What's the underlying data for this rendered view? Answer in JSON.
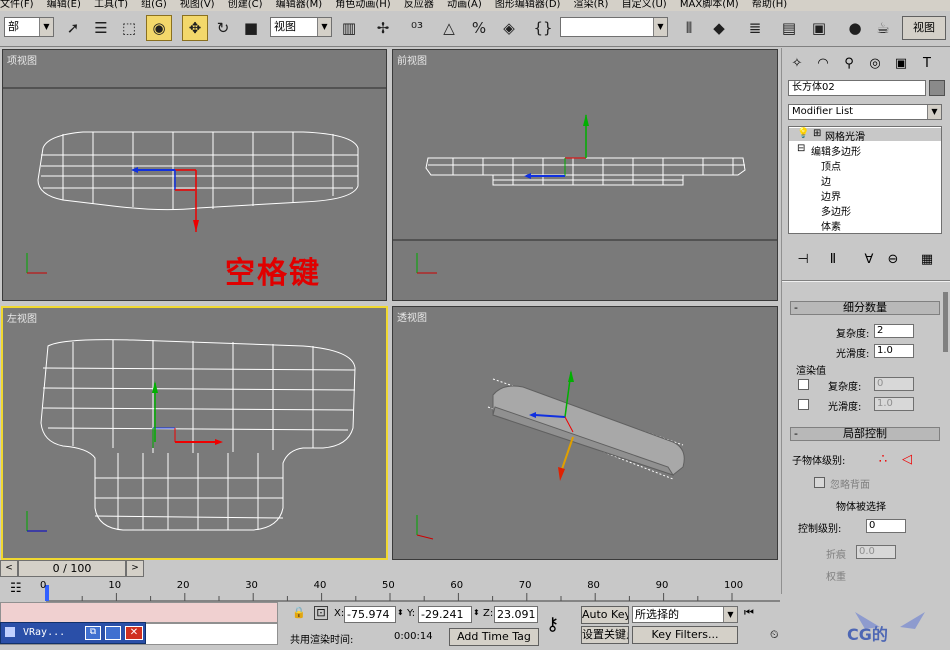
{
  "menu": [
    "文件(F)",
    "编辑(E)",
    "工具(T)",
    "组(G)",
    "视图(V)",
    "创建(C)",
    "编辑器(M)",
    "角色动画(H)",
    "反应器",
    "动画(A)",
    "图形编辑器(D)",
    "渲染(R)",
    "自定义(U)",
    "MAX脚本(M)",
    "帮助(H)"
  ],
  "toolbar": {
    "selection_filter": "部",
    "ref_coord": "视图",
    "named_selection": "",
    "view_button": "视图"
  },
  "viewports": {
    "top": {
      "label": "项视图",
      "overlay_text": "空格键"
    },
    "front": {
      "label": "前视图"
    },
    "left": {
      "label": "左视图"
    },
    "perspective": {
      "label": "透视图"
    }
  },
  "command_panel": {
    "object_name": "长方体02",
    "modifier_list": "Modifier List",
    "stack": {
      "meshsmooth": "网格光滑",
      "edit_poly": "编辑多边形",
      "vertex": "顶点",
      "edge": "边",
      "border": "边界",
      "polygon": "多边形",
      "element": "体素"
    },
    "subdivision": {
      "title": "细分数量",
      "iterations_label": "复杂度:",
      "iterations": "2",
      "smoothness_label": "光滑度:",
      "smoothness": "1.0",
      "render_values": "渲染值",
      "r_iterations_label": "复杂度:",
      "r_iterations": "0",
      "r_smoothness_label": "光滑度:",
      "r_smoothness": "1.0"
    },
    "local_control": {
      "title": "局部控制",
      "sublevel_label": "子物体级别:",
      "ignore_backfacing": "忽略背面",
      "object_selected": "物体被选择",
      "control_level_label": "控制级别:",
      "control_level": "0",
      "crease_label": "折痕",
      "crease": "0.0",
      "weight_label": "权重"
    }
  },
  "time": {
    "frame": "0 / 100",
    "ticks": [
      "0",
      "10",
      "20",
      "30",
      "40",
      "50",
      "60",
      "70",
      "80",
      "90",
      "100"
    ]
  },
  "status": {
    "x_label": "X:",
    "x": "-75.974",
    "y_label": "Y:",
    "y": "-29.241",
    "z_label": "Z:",
    "z": "23.091",
    "auto_key": "Auto Key",
    "set_key": "设置关键点",
    "selection_set": "所选择的",
    "key_filters": "Key Filters...",
    "render_time_label": "共用渲染时间:",
    "render_time": "0:00:14",
    "add_time_tag": "Add Time Tag"
  },
  "taskbar": {
    "window_title": "VRay..."
  },
  "watermark": {
    "text": "CG的"
  }
}
